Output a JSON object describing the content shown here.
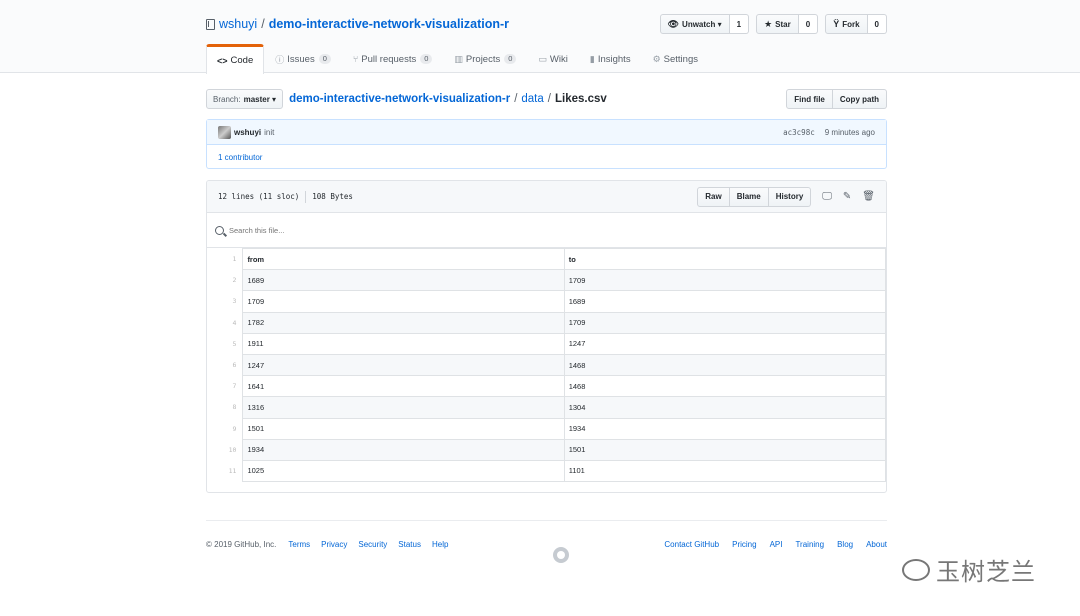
{
  "repo": {
    "owner": "wshuyi",
    "separator": "/",
    "name": "demo-interactive-network-visualization-r",
    "watch": {
      "label": "Unwatch",
      "count": "1"
    },
    "star": {
      "label": "Star",
      "count": "0"
    },
    "fork": {
      "label": "Fork",
      "count": "0"
    }
  },
  "tabs": [
    {
      "label": "Code",
      "icon": "code-icon"
    },
    {
      "label": "Issues",
      "count": "0",
      "icon": "issue-icon"
    },
    {
      "label": "Pull requests",
      "count": "0",
      "icon": "pull-request-icon"
    },
    {
      "label": "Projects",
      "count": "0",
      "icon": "project-icon"
    },
    {
      "label": "Wiki",
      "icon": "book-icon"
    },
    {
      "label": "Insights",
      "icon": "graph-icon"
    },
    {
      "label": "Settings",
      "icon": "gear-icon"
    }
  ],
  "file_nav": {
    "branch_label": "Branch:",
    "branch_value": "master",
    "crumb_root": "demo-interactive-network-visualization-r",
    "crumb_dir": "data",
    "crumb_file": "Likes.csv",
    "find_file": "Find file",
    "copy_path": "Copy path"
  },
  "commit": {
    "author": "wshuyi",
    "message": "init",
    "sha": "ac3c98c",
    "time": "9 minutes ago",
    "contributors": "1 contributor"
  },
  "file": {
    "lines": "12 lines (11 sloc)",
    "size": "108 Bytes",
    "raw": "Raw",
    "blame": "Blame",
    "history": "History",
    "search_placeholder": "Search this file...",
    "header": [
      "from",
      "to"
    ],
    "rows": [
      [
        "1689",
        "1709"
      ],
      [
        "1709",
        "1689"
      ],
      [
        "1782",
        "1709"
      ],
      [
        "1911",
        "1247"
      ],
      [
        "1247",
        "1468"
      ],
      [
        "1641",
        "1468"
      ],
      [
        "1316",
        "1304"
      ],
      [
        "1501",
        "1934"
      ],
      [
        "1934",
        "1501"
      ],
      [
        "1025",
        "1101"
      ]
    ],
    "line_numbers": [
      "1",
      "2",
      "3",
      "4",
      "5",
      "6",
      "7",
      "8",
      "9",
      "10",
      "11"
    ]
  },
  "footer": {
    "copyright": "© 2019 GitHub, Inc.",
    "left_links": [
      "Terms",
      "Privacy",
      "Security",
      "Status",
      "Help"
    ],
    "right_links": [
      "Contact GitHub",
      "Pricing",
      "API",
      "Training",
      "Blog",
      "About"
    ]
  },
  "watermark": {
    "text": "玉树芝兰"
  }
}
